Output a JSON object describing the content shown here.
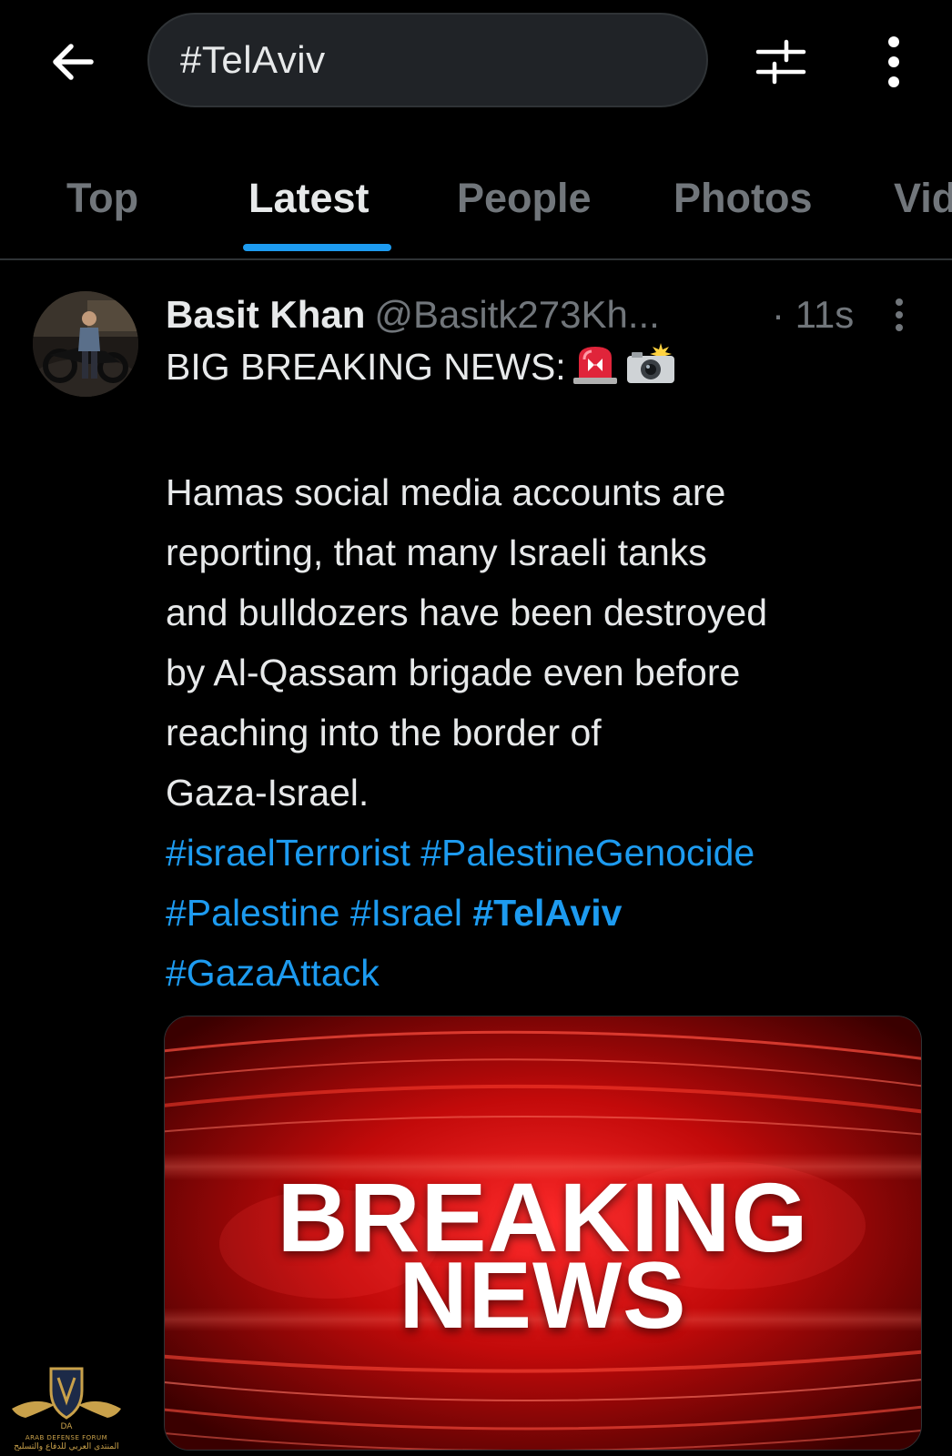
{
  "search": {
    "query": "#TelAviv"
  },
  "tabs": [
    {
      "label": "Top",
      "active": false
    },
    {
      "label": "Latest",
      "active": true
    },
    {
      "label": "People",
      "active": false
    },
    {
      "label": "Photos",
      "active": false
    },
    {
      "label": "Vid",
      "active": false
    }
  ],
  "tweet": {
    "author_name": "Basit Khan",
    "author_handle": "@Basitk273Kh...",
    "time": "· 11s",
    "lines": [
      "BIG BREAKING NEWS:",
      "Hamas social media accounts are",
      "reporting, that many Israeli tanks",
      "and bulldozers have been destroyed",
      "by Al-Qassam brigade even before",
      "reaching into the border of",
      "Gaza-Israel."
    ],
    "emojis": [
      "police-car-light-emoji",
      "camera-with-flash-emoji"
    ],
    "hashtags": [
      [
        "#israelTerrorist",
        "#PalestineGenocide"
      ],
      [
        "#Palestine",
        "#Israel",
        "#TelAviv"
      ],
      [
        "#GazaAttack"
      ]
    ],
    "media": {
      "line1": "BREAKING",
      "line2": "NEWS"
    }
  },
  "watermark": {
    "en": "ARAB DEFENSE FORUM",
    "ar": "المنتدى العربي للدفاع والتسليح"
  },
  "colors": {
    "background": "#000000",
    "accent": "#1d9bf0",
    "text_primary": "#e7e9ea",
    "text_secondary": "#71767b",
    "search_bg": "#202327",
    "media_red": "#d01010"
  }
}
